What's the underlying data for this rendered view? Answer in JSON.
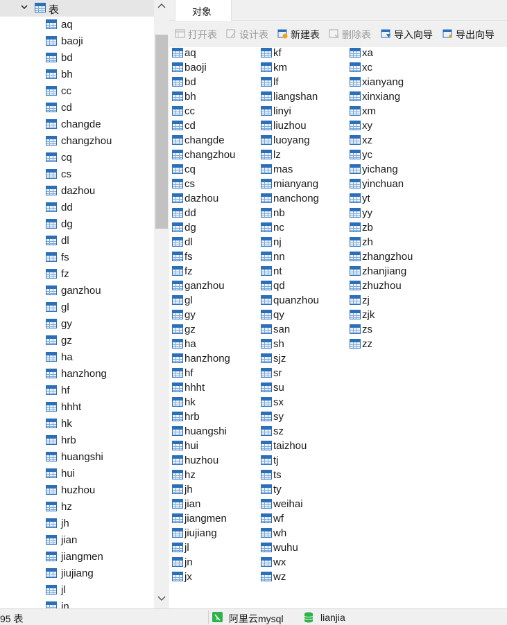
{
  "tree": {
    "header_label": "表",
    "items": [
      "aq",
      "baoji",
      "bd",
      "bh",
      "cc",
      "cd",
      "changde",
      "changzhou",
      "cq",
      "cs",
      "dazhou",
      "dd",
      "dg",
      "dl",
      "fs",
      "fz",
      "ganzhou",
      "gl",
      "gy",
      "gz",
      "ha",
      "hanzhong",
      "hf",
      "hhht",
      "hk",
      "hrb",
      "huangshi",
      "hui",
      "huzhou",
      "hz",
      "jh",
      "jian",
      "jiangmen",
      "jiujiang",
      "jl",
      "jn"
    ]
  },
  "tabs": [
    {
      "label": "对象"
    }
  ],
  "toolbar": {
    "open": "打开表",
    "design": "设计表",
    "new": "新建表",
    "delete": "删除表",
    "import": "导入向导",
    "export": "导出向导"
  },
  "objects": {
    "col1": [
      "aq",
      "baoji",
      "bd",
      "bh",
      "cc",
      "cd",
      "changde",
      "changzhou",
      "cq",
      "cs",
      "dazhou",
      "dd",
      "dg",
      "dl",
      "fs",
      "fz",
      "ganzhou",
      "gl",
      "gy",
      "gz",
      "ha",
      "hanzhong",
      "hf",
      "hhht",
      "hk",
      "hrb",
      "huangshi",
      "hui",
      "huzhou",
      "hz",
      "jh",
      "jian",
      "jiangmen",
      "jiujiang",
      "jl",
      "jn",
      "jx"
    ],
    "col2": [
      "kf",
      "km",
      "lf",
      "liangshan",
      "linyi",
      "liuzhou",
      "luoyang",
      "lz",
      "mas",
      "mianyang",
      "nanchong",
      "nb",
      "nc",
      "nj",
      "nn",
      "nt",
      "qd",
      "quanzhou",
      "qy",
      "san",
      "sh",
      "sjz",
      "sr",
      "su",
      "sx",
      "sy",
      "sz",
      "taizhou",
      "tj",
      "ts",
      "ty",
      "weihai",
      "wf",
      "wh",
      "wuhu",
      "wx",
      "wz"
    ],
    "col3": [
      "xa",
      "xc",
      "xianyang",
      "xinxiang",
      "xm",
      "xy",
      "xz",
      "yc",
      "yichang",
      "yinchuan",
      "yt",
      "yy",
      "zb",
      "zh",
      "zhangzhou",
      "zhanjiang",
      "zhuzhou",
      "zj",
      "zjk",
      "zs",
      "zz"
    ]
  },
  "status": {
    "count": "95 表",
    "connection": "阿里云mysql",
    "database": "lianjia"
  },
  "colors": {
    "table_icon": "#2c6fb7",
    "panel_bg": "#f0f0f0",
    "connection_icon": "#2eb34a",
    "database_icon": "#2eb34a"
  }
}
